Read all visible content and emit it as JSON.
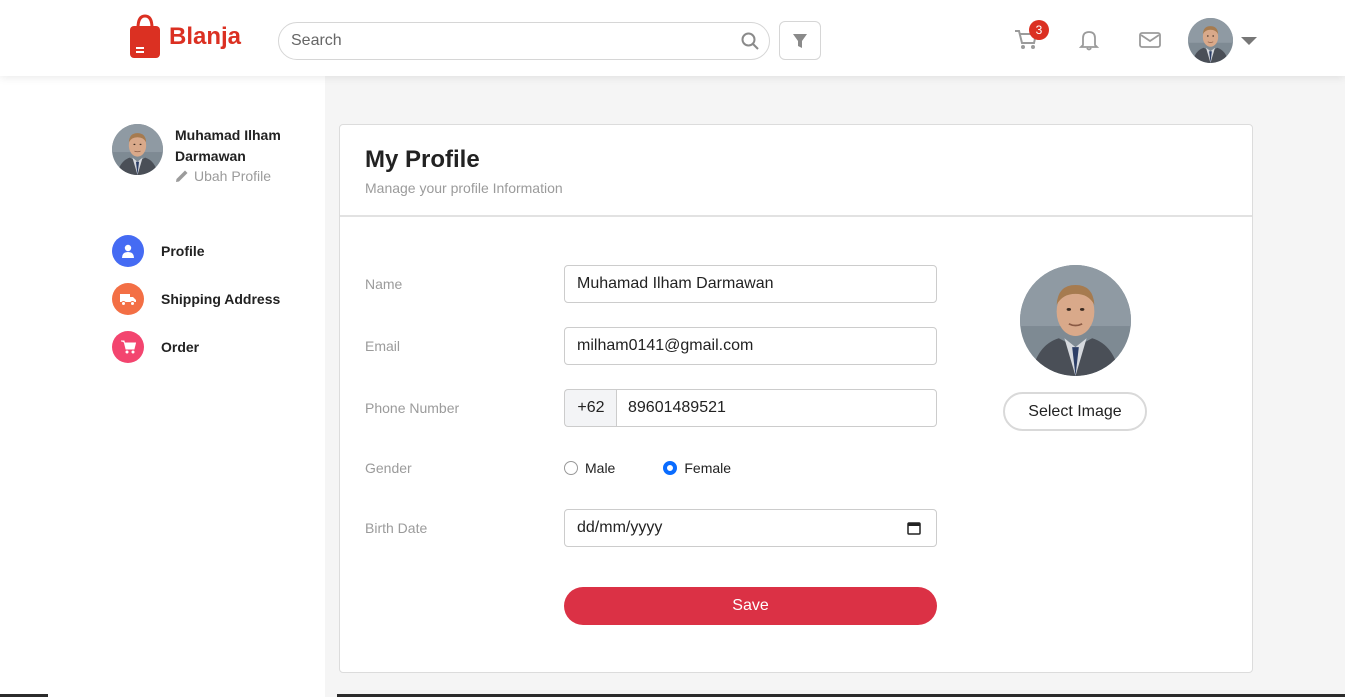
{
  "header": {
    "brand": "Blanja",
    "search": {
      "placeholder": "Search",
      "value": ""
    },
    "cart_count": "3",
    "icons": [
      "search-icon",
      "filter-icon",
      "cart-icon",
      "bell-icon",
      "mail-icon",
      "chevron-down-icon"
    ],
    "brand_color": "#db3022"
  },
  "sidebar": {
    "user_name": "Muhamad Ilham Darmawan",
    "edit_label": "Ubah Profile",
    "items": [
      {
        "label": "Profile",
        "icon": "user-icon",
        "color": "#456bf3"
      },
      {
        "label": "Shipping Address",
        "icon": "truck-icon",
        "color": "#f36f45"
      },
      {
        "label": "Order",
        "icon": "cart-icon",
        "color": "#f3456f"
      }
    ]
  },
  "profile": {
    "title": "My Profile",
    "subtitle": "Manage your profile Information",
    "fields": {
      "name_label": "Name",
      "name_value": "Muhamad Ilham Darmawan",
      "email_label": "Email",
      "email_value": "milham0141@gmail.com",
      "phone_label": "Phone Number",
      "phone_prefix": "+62",
      "phone_value": "89601489521",
      "gender_label": "Gender",
      "gender_options": [
        "Male",
        "Female"
      ],
      "gender_selected": "Female",
      "birth_label": "Birth Date",
      "birth_placeholder": "dd/mm/yyyy"
    },
    "save_label": "Save",
    "select_image_label": "Select Image",
    "save_color": "#db3145"
  }
}
